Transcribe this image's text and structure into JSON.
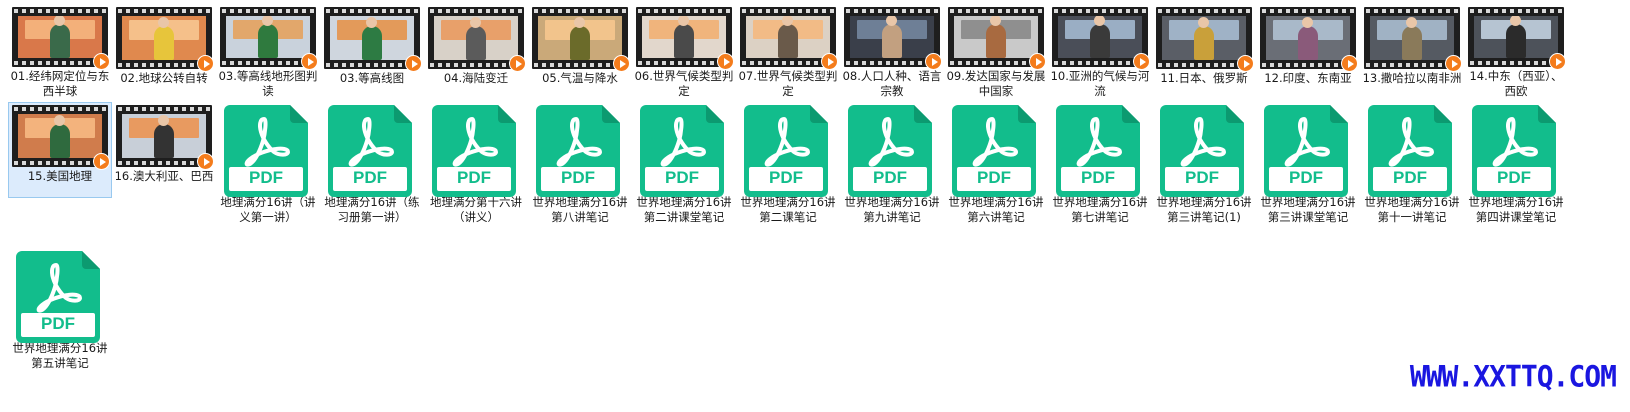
{
  "files": [
    {
      "type": "video",
      "label": "01.经纬网定位与东西半球"
    },
    {
      "type": "video",
      "label": "02.地球公转自转"
    },
    {
      "type": "video",
      "label": "03.等高线地形图判读"
    },
    {
      "type": "video",
      "label": "03.等高线图"
    },
    {
      "type": "video",
      "label": "04.海陆变迁"
    },
    {
      "type": "video",
      "label": "05.气温与降水"
    },
    {
      "type": "video",
      "label": "06.世界气候类型判定"
    },
    {
      "type": "video",
      "label": "07.世界气候类型判定"
    },
    {
      "type": "video",
      "label": "08.人口人种、语言宗教"
    },
    {
      "type": "video",
      "label": "09.发达国家与发展中国家"
    },
    {
      "type": "video",
      "label": "10.亚洲的气候与河流"
    },
    {
      "type": "video",
      "label": "11.日本、俄罗斯"
    },
    {
      "type": "video",
      "label": "12.印度、东南亚"
    },
    {
      "type": "video",
      "label": "13.撒哈拉以南非洲"
    },
    {
      "type": "video",
      "label": "14.中东（西亚）、西欧"
    },
    {
      "type": "video",
      "label": "15.美国地理",
      "selected": true
    },
    {
      "type": "video",
      "label": "16.澳大利亚、巴西"
    },
    {
      "type": "pdf",
      "label": "地理满分16讲（讲义第一讲）"
    },
    {
      "type": "pdf",
      "label": "地理满分16讲（练习册第一讲）"
    },
    {
      "type": "pdf",
      "label": "地理满分第十六讲（讲义）"
    },
    {
      "type": "pdf",
      "label": "世界地理满分16讲第八讲笔记"
    },
    {
      "type": "pdf",
      "label": "世界地理满分16讲第二讲课堂笔记"
    },
    {
      "type": "pdf",
      "label": "世界地理满分16讲第二课笔记"
    },
    {
      "type": "pdf",
      "label": "世界地理满分16讲第九讲笔记"
    },
    {
      "type": "pdf",
      "label": "世界地理满分16讲第六讲笔记"
    },
    {
      "type": "pdf",
      "label": "世界地理满分16讲第七讲笔记"
    },
    {
      "type": "pdf",
      "label": "世界地理满分16讲第三讲笔记(1)"
    },
    {
      "type": "pdf",
      "label": "世界地理满分16讲第三讲课堂笔记"
    },
    {
      "type": "pdf",
      "label": "世界地理满分16讲第十一讲笔记"
    },
    {
      "type": "pdf",
      "label": "世界地理满分16讲第四讲课堂笔记"
    },
    {
      "type": "pdf",
      "label": "世界地理满分16讲第五讲笔记"
    }
  ],
  "pdf_badge": "PDF",
  "watermark": "WWW.XXTTQ.COM",
  "colors": {
    "pdf_green": "#12bd8c",
    "play_orange": "#f47c1c",
    "watermark_blue": "#1a16e0",
    "selection": "#dcebfc"
  },
  "icons": {
    "video": "video-file-icon",
    "pdf": "pdf-file-icon",
    "play": "play-icon"
  }
}
